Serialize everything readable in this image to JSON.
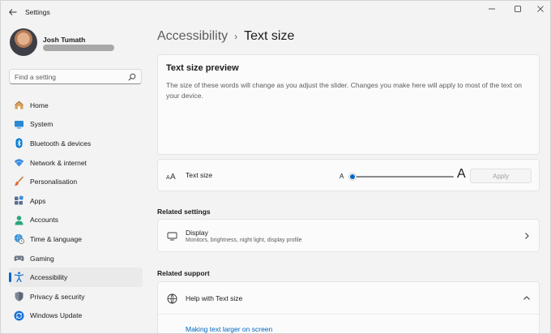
{
  "window": {
    "title": "Settings",
    "icons": {
      "back": "back-arrow-icon",
      "minimize": "minimize-icon",
      "maximize": "maximize-icon",
      "close": "close-icon"
    }
  },
  "profile": {
    "name": "Josh Tumath"
  },
  "search": {
    "placeholder": "Find a setting",
    "value": "",
    "icon": "search-icon"
  },
  "sidebar": {
    "items": [
      {
        "label": "Home",
        "icon": "home-icon",
        "active": false
      },
      {
        "label": "System",
        "icon": "system-icon",
        "active": false
      },
      {
        "label": "Bluetooth & devices",
        "icon": "bluetooth-icon",
        "active": false
      },
      {
        "label": "Network & internet",
        "icon": "wifi-icon",
        "active": false
      },
      {
        "label": "Personalisation",
        "icon": "brush-icon",
        "active": false
      },
      {
        "label": "Apps",
        "icon": "apps-icon",
        "active": false
      },
      {
        "label": "Accounts",
        "icon": "accounts-icon",
        "active": false
      },
      {
        "label": "Time & language",
        "icon": "globe-clock-icon",
        "active": false
      },
      {
        "label": "Gaming",
        "icon": "gaming-icon",
        "active": false
      },
      {
        "label": "Accessibility",
        "icon": "accessibility-icon",
        "active": true
      },
      {
        "label": "Privacy & security",
        "icon": "shield-icon",
        "active": false
      },
      {
        "label": "Windows Update",
        "icon": "update-icon",
        "active": false
      }
    ]
  },
  "breadcrumb": {
    "parent": "Accessibility",
    "separator": "›",
    "current": "Text size"
  },
  "preview": {
    "title": "Text size preview",
    "text": "The size of these words will change as you adjust the slider. Changes you make here will apply to most of the text on your device."
  },
  "text_size": {
    "label": "Text size",
    "icon": "text-size-icon",
    "small_marker": "A",
    "large_marker": "A",
    "slider_fraction": 0,
    "apply_label": "Apply",
    "apply_enabled": false
  },
  "related_settings": {
    "heading": "Related settings",
    "display": {
      "label": "Display",
      "description": "Monitors, brightness, night light, display profile",
      "icon": "monitor-icon",
      "chevron": "chevron-right-icon"
    }
  },
  "related_support": {
    "heading": "Related support",
    "help": {
      "label": "Help with Text size",
      "icon": "globe-icon",
      "chevron": "chevron-up-icon"
    },
    "link": "Making text larger on screen"
  },
  "colors": {
    "accent": "#0067c0"
  }
}
